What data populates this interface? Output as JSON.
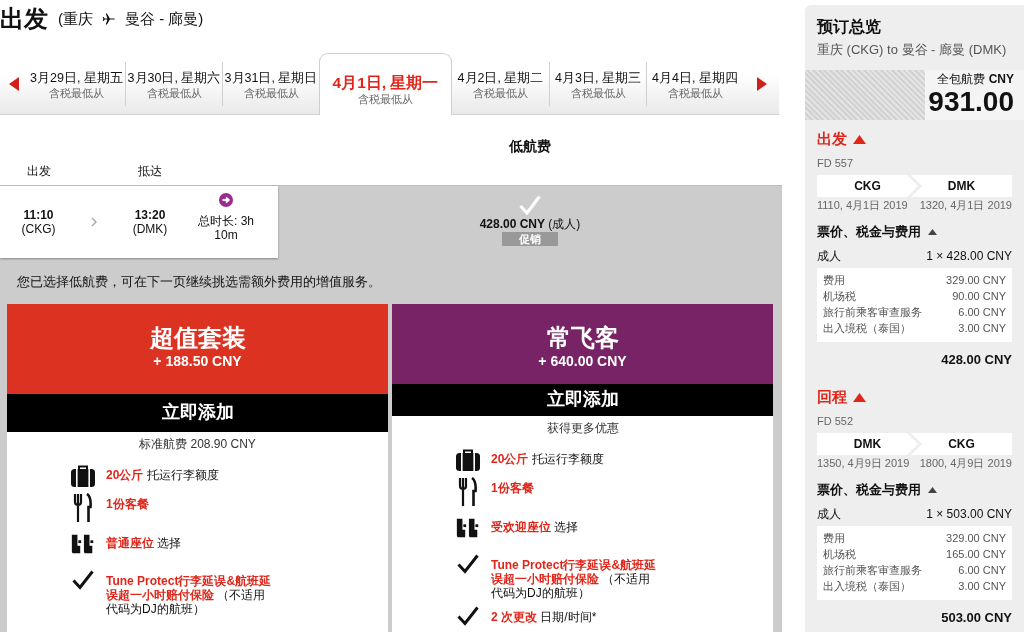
{
  "header": {
    "title": "出发",
    "route_from": "(重庆",
    "route_to": "曼谷 - 廊曼)"
  },
  "date_tabs": [
    {
      "date": "3月29日, 星期五",
      "note": "含税最低从",
      "selected": false
    },
    {
      "date": "3月30日, 星期六",
      "note": "含税最低从",
      "selected": false
    },
    {
      "date": "3月31日, 星期日",
      "note": "含税最低从",
      "selected": false
    },
    {
      "date": "4月1日, 星期一",
      "note": "含税最低从",
      "selected": true
    },
    {
      "date": "4月2日, 星期二",
      "note": "含税最低从",
      "selected": false
    },
    {
      "date": "4月3日, 星期三",
      "note": "含税最低从",
      "selected": false
    },
    {
      "date": "4月4日, 星期四",
      "note": "含税最低从",
      "selected": false
    }
  ],
  "fare_header": "低航费",
  "flight_headers": [
    "出发",
    "抵达"
  ],
  "flight": {
    "depart_time": "11:10",
    "depart_airport": "(CKG)",
    "arrive_time": "13:20",
    "arrive_airport": "(DMK)",
    "duration": "总时长: 3h 10m"
  },
  "fare": {
    "selected": true,
    "price": "428.00 CNY",
    "passenger": "(成人)",
    "tag": "促销"
  },
  "notice": "您已选择低航费，可在下一页继续挑选需额外费用的增值服务。",
  "packages": [
    {
      "title": "超值套装",
      "price": "+ 188.50 CNY",
      "color": "#dc3222",
      "button": "立即添加",
      "subtitle": "标准航费 208.90 CNY",
      "features": [
        {
          "kind": "baggage",
          "highlight": "20公斤",
          "detail": "托运行李额度"
        },
        {
          "kind": "meal",
          "highlight": "1份客餐"
        },
        {
          "kind": "seat",
          "highlight": "普通座位",
          "detail": "选择"
        },
        {
          "kind": "tick",
          "highlight": "Tune Protect行李延误&航班延误超一小时赔付保险",
          "detail": "（不适用代码为DJ的航班）"
        }
      ]
    },
    {
      "title": "常飞客",
      "price": "+ 640.00 CNY",
      "color": "#772365",
      "button": "立即添加",
      "subtitle": "获得更多优惠",
      "features": [
        {
          "kind": "baggage",
          "highlight": "20公斤",
          "detail": "托运行李额度"
        },
        {
          "kind": "meal",
          "highlight": "1份客餐"
        },
        {
          "kind": "seat",
          "highlight": "受欢迎座位",
          "detail": "选择"
        },
        {
          "kind": "tick",
          "highlight": "Tune Protect行李延误&航班延误超一小时赔付保险",
          "detail": "（不适用代码为DJ的航班）"
        },
        {
          "kind": "tick",
          "highlight": "2 次更改",
          "detail": "日期/时间*"
        }
      ]
    }
  ],
  "summary": {
    "title": "预订总览",
    "route": "重庆 (CKG) to 曼谷 - 廊曼 (DMK)",
    "total_label": "全包航费 **CNY**",
    "total": "931.00",
    "legs": [
      {
        "title": "出发",
        "expanded": true,
        "flight_number": "FD 557",
        "from": "CKG",
        "to": "DMK",
        "depart": "1110, 4月1日 2019",
        "arrive": "1320, 4月1日 2019",
        "fees_title": "票价、税金与费用",
        "fees_expanded": true,
        "passenger": "成人",
        "passenger_price": "1 × 428.00 CNY",
        "fees": [
          {
            "label": "费用",
            "amount": "329.00 CNY"
          },
          {
            "label": "机场税",
            "amount": "90.00 CNY"
          },
          {
            "label": "旅行前乘客审查服务",
            "amount": "6.00 CNY"
          },
          {
            "label": "出入境税（泰国）",
            "amount": "3.00 CNY"
          }
        ],
        "subtotal": "428.00 CNY"
      },
      {
        "title": "回程",
        "expanded": true,
        "flight_number": "FD 552",
        "from": "DMK",
        "to": "CKG",
        "depart": "1350, 4月9日 2019",
        "arrive": "1800, 4月9日 2019",
        "fees_title": "票价、税金与费用",
        "fees_expanded": true,
        "passenger": "成人",
        "passenger_price": "1 × 503.00 CNY",
        "fees": [
          {
            "label": "费用",
            "amount": "329.00 CNY"
          },
          {
            "label": "机场税",
            "amount": "165.00 CNY"
          },
          {
            "label": "旅行前乘客审查服务",
            "amount": "6.00 CNY"
          },
          {
            "label": "出入境税（泰国）",
            "amount": "3.00 CNY"
          }
        ],
        "subtotal": "503.00 CNY"
      }
    ]
  }
}
